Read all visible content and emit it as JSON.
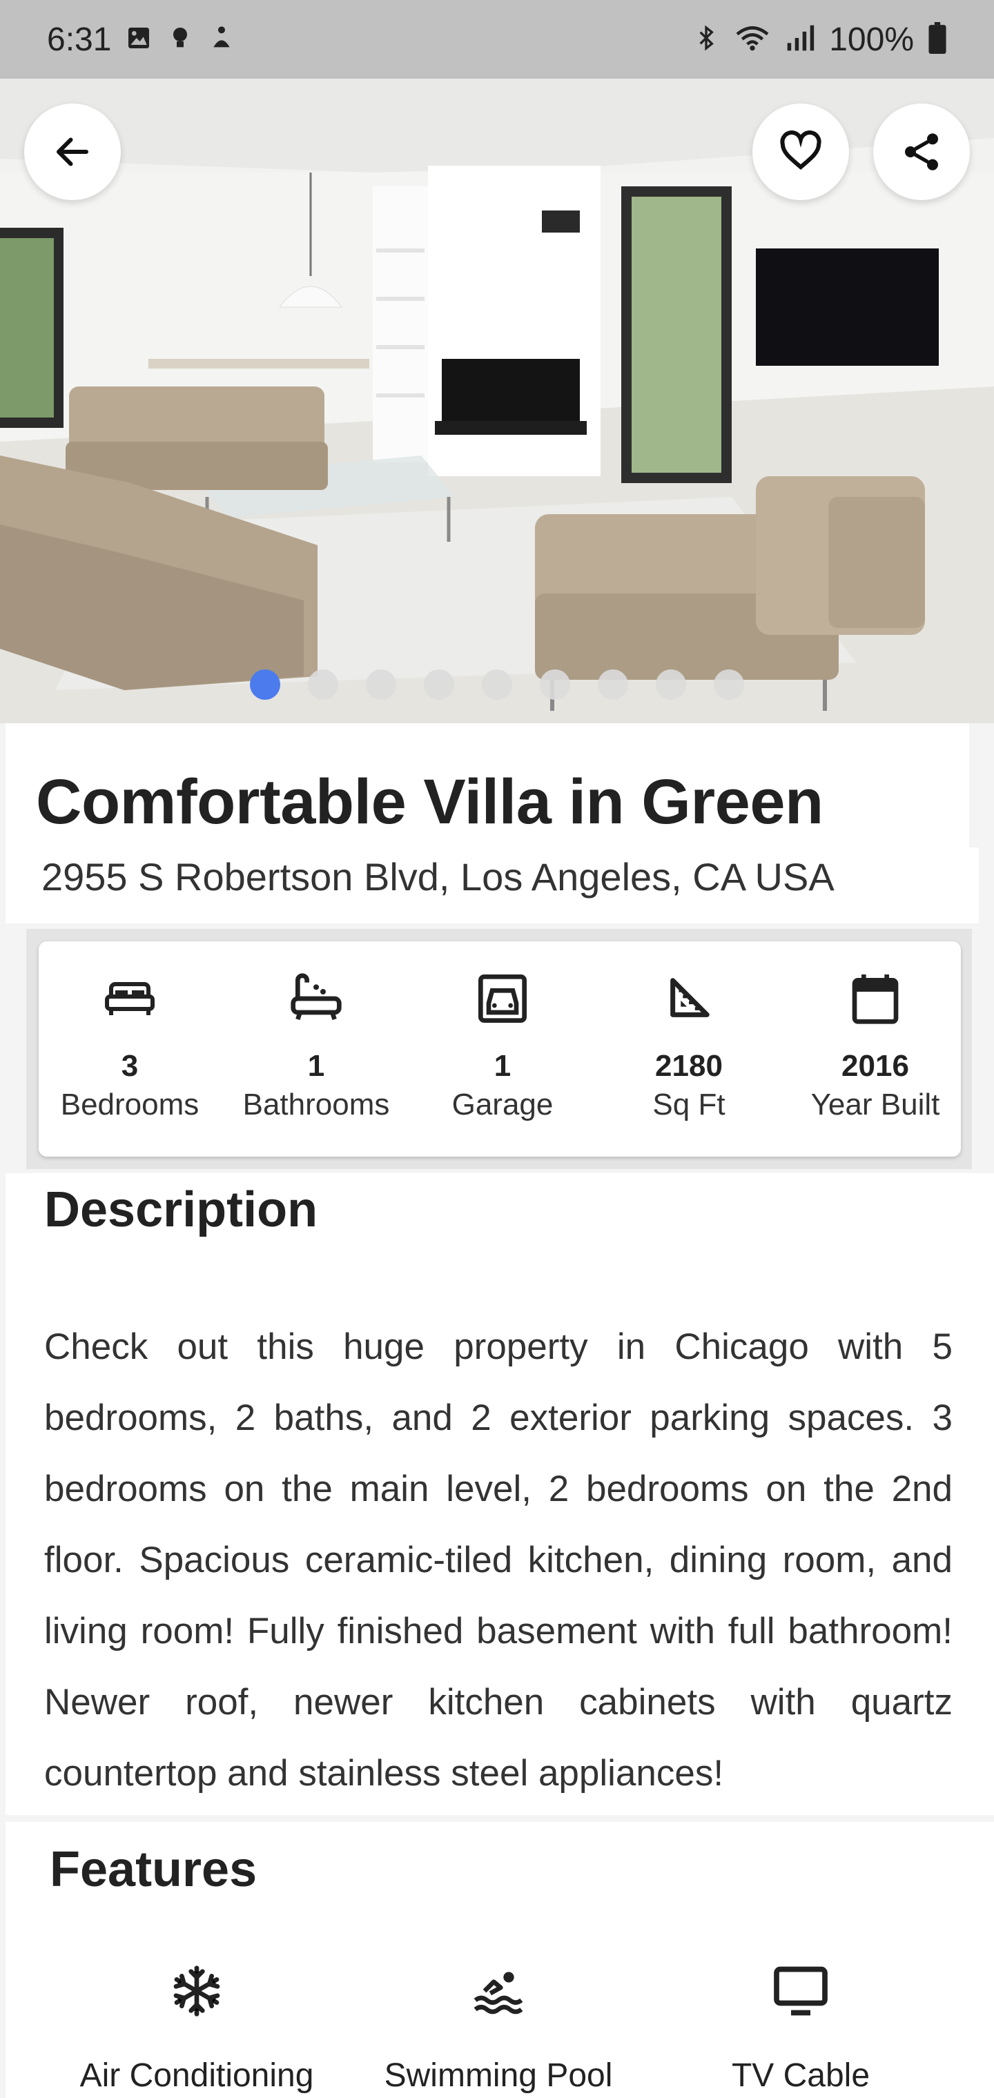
{
  "status_bar": {
    "time": "6:31",
    "battery": "100%"
  },
  "gallery": {
    "image_count": 9,
    "active_index": 0
  },
  "listing": {
    "title": "Comfortable Villa in Green",
    "address": "2955 S Robertson Blvd, Los Angeles, CA  USA"
  },
  "stats": [
    {
      "icon": "bed-icon",
      "value": "3",
      "label": "Bedrooms"
    },
    {
      "icon": "bathtub-icon",
      "value": "1",
      "label": "Bathrooms"
    },
    {
      "icon": "garage-icon",
      "value": "1",
      "label": "Garage"
    },
    {
      "icon": "ruler-square-icon",
      "value": "2180",
      "label": "Sq Ft"
    },
    {
      "icon": "calendar-icon",
      "value": "2016",
      "label": "Year Built"
    }
  ],
  "description": {
    "heading": "Description",
    "text": " Check out this huge property in Chicago with 5 bedrooms, 2 baths, and 2 exterior parking spaces. 3 bedrooms on the main level, 2 bedrooms on the 2nd floor. Spacious ceramic-tiled kitchen, dining room, and living room! Fully finished basement with full bathroom! Newer roof, newer kitchen cabinets with quartz countertop and stainless steel appliances!"
  },
  "features": {
    "heading": "Features",
    "items": [
      {
        "icon": "snowflake-icon",
        "label": "Air Conditioning"
      },
      {
        "icon": "swimming-pool-icon",
        "label": "Swimming Pool"
      },
      {
        "icon": "tv-icon",
        "label": "TV Cable"
      }
    ]
  },
  "colors": {
    "accent": "#4b7bec",
    "text": "#222222"
  }
}
